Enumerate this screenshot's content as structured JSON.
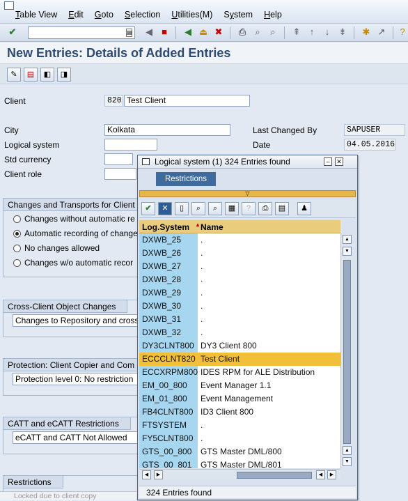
{
  "menu": {
    "items": [
      {
        "label": "Table View",
        "u": "T"
      },
      {
        "label": "Edit",
        "u": "E"
      },
      {
        "label": "Goto",
        "u": "G"
      },
      {
        "label": "Selection",
        "u": "S"
      },
      {
        "label": "Utilities(M)",
        "u": "U"
      },
      {
        "label": "System",
        "u": "y"
      },
      {
        "label": "Help",
        "u": "H"
      }
    ]
  },
  "page": {
    "title": "New Entries: Details of Added Entries"
  },
  "form": {
    "client_label": "Client",
    "client_value": "820",
    "client_name": "Test Client",
    "city_label": "City",
    "city_value": "Kolkata",
    "logical_system_label": "Logical system",
    "logical_system_value": "",
    "std_currency_label": "Std currency",
    "std_currency_value": "",
    "client_role_label": "Client role",
    "client_role_value": "",
    "last_changed_by_label": "Last Changed By",
    "last_changed_by_value": "SAPUSER",
    "date_label": "Date",
    "date_value": "04.05.2016"
  },
  "groups": {
    "changes_title": "Changes and Transports for Client",
    "changes_options": [
      {
        "label": "Changes without automatic re",
        "selected": false
      },
      {
        "label": "Automatic recording of change",
        "selected": true
      },
      {
        "label": "No changes allowed",
        "selected": false
      },
      {
        "label": "Changes w/o automatic recor",
        "selected": false
      }
    ],
    "cross_client_title": "Cross-Client Object Changes",
    "cross_client_value": "Changes to Repository and cross",
    "protection_title": "Protection: Client Copier and Com",
    "protection_value": "Protection level 0: No restriction",
    "catt_title": "CATT and eCATT Restrictions",
    "catt_value": "eCATT and CATT Not Allowed",
    "restrictions_title": "Restrictions",
    "restrictions_hint": "Locked due to client copy"
  },
  "popup": {
    "title": "Logical system (1)  324 Entries found",
    "tab_label": "Restrictions",
    "col_logsys": "Log.System",
    "col_name": "Name",
    "rows": [
      {
        "sys": "DXWB_25",
        "name": "."
      },
      {
        "sys": "DXWB_26",
        "name": "."
      },
      {
        "sys": "DXWB_27",
        "name": "."
      },
      {
        "sys": "DXWB_28",
        "name": "."
      },
      {
        "sys": "DXWB_29",
        "name": "."
      },
      {
        "sys": "DXWB_30",
        "name": "."
      },
      {
        "sys": "DXWB_31",
        "name": "."
      },
      {
        "sys": "DXWB_32",
        "name": "."
      },
      {
        "sys": "DY3CLNT800",
        "name": "DY3 Client 800"
      },
      {
        "sys": "ECCCLNT820",
        "name": "Test Client",
        "selected": true
      },
      {
        "sys": "ECCXRPM800",
        "name": "IDES RPM for ALE Distribution"
      },
      {
        "sys": "EM_00_800",
        "name": "Event Manager 1.1"
      },
      {
        "sys": "EM_01_800",
        "name": "Event Management"
      },
      {
        "sys": "FB4CLNT800",
        "name": "ID3 Client 800"
      },
      {
        "sys": "FTSYSTEM",
        "name": "."
      },
      {
        "sys": "FY5CLNT800",
        "name": "."
      },
      {
        "sys": "GTS_00_800",
        "name": "GTS Master DML/800"
      },
      {
        "sys": "GTS_00_801",
        "name": "GTS Master DML/801"
      }
    ],
    "status": "324 Entries found"
  },
  "colors": {
    "accent": "#3f6a9c",
    "selection": "#f2c038",
    "key_column": "#a7d6f0",
    "header": "#e9cc7c"
  }
}
